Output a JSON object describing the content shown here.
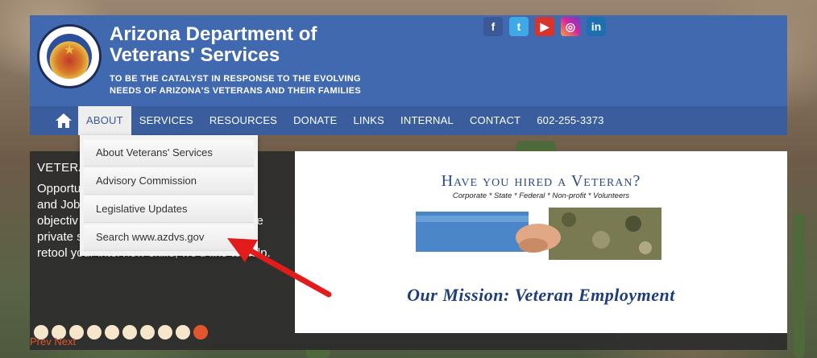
{
  "header": {
    "title_line1": "Arizona Department of",
    "title_line2": "Veterans' Services",
    "tagline_line1": "TO BE THE CATALYST IN RESPONSE TO THE EVOLVING",
    "tagline_line2": "NEEDS OF ARIZONA'S VETERANS AND THEIR FAMILIES"
  },
  "social": {
    "facebook": "f",
    "twitter": "t",
    "youtube": "▶",
    "instagram": "◎",
    "linkedin": "in"
  },
  "nav": {
    "items": [
      "ABOUT",
      "SERVICES",
      "RESOURCES",
      "DONATE",
      "LINKS",
      "INTERNAL",
      "CONTACT",
      "602-255-3373"
    ]
  },
  "dropdown": {
    "items": [
      "About Veterans' Services",
      "Advisory Commission",
      "Legislative Updates",
      "Search www.azdvs.gov"
    ]
  },
  "slider": {
    "title": "VETERAN",
    "body_line1": "Opportu",
    "body_line2": "and Job",
    "body_line3": "objectiv",
    "body_line3b": "e",
    "body_line4": "private s",
    "body_line5": "retool your interview skills, we'd like to help.",
    "image_title": "Have you hired a Veteran?",
    "image_subtitle": "Corporate * State * Federal * Non-profit * Volunteers",
    "image_mission": "Our Mission: Veteran Employment",
    "prev": "Prev",
    "next": "Next",
    "dots": 10,
    "active_dot": 10
  },
  "colors": {
    "header_blue": "#4169b0",
    "nav_blue": "#3a5e9d",
    "accent_orange": "#e2562b",
    "arrow_red": "#e31b1b"
  }
}
